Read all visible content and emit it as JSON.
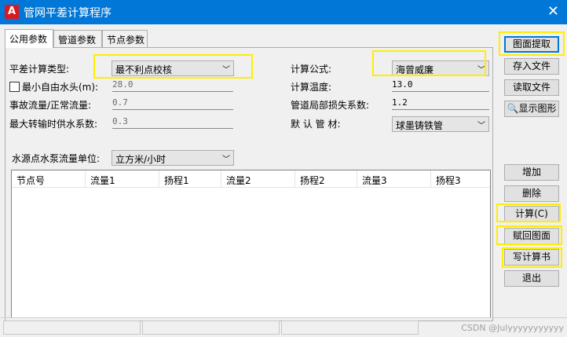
{
  "window": {
    "app_icon_letter": "A",
    "title": "管网平差计算程序",
    "close_glyph": "✕"
  },
  "tabs": [
    {
      "label": "公用参数",
      "active": true
    },
    {
      "label": "管道参数",
      "active": false
    },
    {
      "label": "节点参数",
      "active": false
    }
  ],
  "form": {
    "calc_type": {
      "label": "平差计算类型:",
      "value": "最不利点校核"
    },
    "min_head": {
      "label": "最小自由水头(m):",
      "value": "28.0",
      "checked": false
    },
    "accident_ratio": {
      "label": "事故流量/正常流量:",
      "value": "0.7"
    },
    "max_transfer": {
      "label": "最大转输时供水系数:",
      "value": "0.3"
    },
    "formula": {
      "label": "计算公式:",
      "value": "海曾威廉"
    },
    "temperature": {
      "label": "计算温度:",
      "value": "13.0"
    },
    "local_loss": {
      "label": "管道局部损失系数:",
      "value": "1.2"
    },
    "material": {
      "label": "默 认 管 材:",
      "value": "球墨铸铁管"
    },
    "flow_unit": {
      "label": "水源点水泵流量单位:",
      "value": "立方米/小时"
    }
  },
  "table": {
    "columns": [
      "节点号",
      "流量1",
      "扬程1",
      "流量2",
      "扬程2",
      "流量3",
      "扬程3"
    ]
  },
  "buttons": {
    "pick": "图面提取",
    "save": "存入文件",
    "read": "读取文件",
    "show": "显示图形",
    "add": "增加",
    "delete": "删除",
    "calc": "计算(C)",
    "return": "赋回图面",
    "write": "写计算书",
    "exit": "退出"
  },
  "watermark": "CSDN @Julyyyyyyyyyyy",
  "colors": {
    "title_bar": "#0178d7",
    "highlight": "#ffee00",
    "app_icon": "#d71920"
  },
  "icons": [
    "autocad-app-icon",
    "close-icon",
    "chevron-down-icon",
    "magnifier-icon",
    "checkbox-icon"
  ]
}
